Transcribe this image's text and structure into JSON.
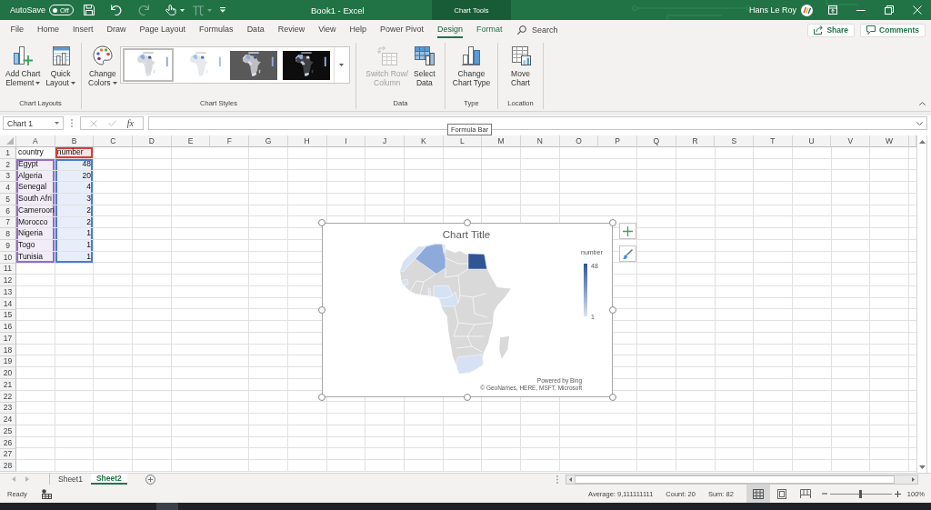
{
  "title_bar": {
    "autosave": {
      "label": "AutoSave",
      "state": "Off",
      "on": false
    },
    "quick_access": [
      {
        "kind": "save",
        "disabled": false,
        "dropdown": false
      },
      {
        "kind": "undo",
        "disabled": false,
        "dropdown": false
      },
      {
        "kind": "redo",
        "disabled": true,
        "dropdown": false
      },
      {
        "kind": "touch",
        "disabled": false,
        "dropdown": true
      },
      {
        "kind": "equation",
        "disabled": true,
        "dropdown": true
      },
      {
        "kind": "customize",
        "disabled": false,
        "dropdown": false
      }
    ],
    "document_title": "Book1 - Excel",
    "context_tab_group": "Chart Tools",
    "user_name": "Hans Le Roy"
  },
  "ribbon_tabs": [
    {
      "label": "File",
      "selected": false,
      "contextual": false
    },
    {
      "label": "Home",
      "selected": false,
      "contextual": false
    },
    {
      "label": "Insert",
      "selected": false,
      "contextual": false
    },
    {
      "label": "Draw",
      "selected": false,
      "contextual": false
    },
    {
      "label": "Page Layout",
      "selected": false,
      "contextual": false
    },
    {
      "label": "Formulas",
      "selected": false,
      "contextual": false
    },
    {
      "label": "Data",
      "selected": false,
      "contextual": false
    },
    {
      "label": "Review",
      "selected": false,
      "contextual": false
    },
    {
      "label": "View",
      "selected": false,
      "contextual": false
    },
    {
      "label": "Help",
      "selected": false,
      "contextual": false
    },
    {
      "label": "Power Pivot",
      "selected": false,
      "contextual": false
    },
    {
      "label": "Design",
      "selected": true,
      "contextual": true
    },
    {
      "label": "Format",
      "selected": false,
      "contextual": true
    }
  ],
  "search": {
    "placeholder": "Search"
  },
  "share_button": {
    "label": "Share"
  },
  "comments_button": {
    "label": "Comments"
  },
  "ribbon_groups": [
    {
      "label": "Chart Layouts",
      "commands": [
        {
          "kind": "add-chart-element",
          "label": "Add Chart\nElement",
          "dropdown": true,
          "disabled": false
        },
        {
          "kind": "quick-layout",
          "label": "Quick\nLayout",
          "dropdown": true,
          "disabled": false
        }
      ]
    },
    {
      "label": "Chart Styles",
      "commands": [
        {
          "kind": "change-colors",
          "label": "Change\nColors",
          "dropdown": true,
          "disabled": false
        }
      ],
      "gallery": [
        {
          "kind": "light",
          "selected": true
        },
        {
          "kind": "light-flat",
          "selected": false
        },
        {
          "kind": "dark-grey",
          "selected": false
        },
        {
          "kind": "black",
          "selected": false
        }
      ]
    },
    {
      "label": "Data",
      "commands": [
        {
          "kind": "switch-row-column",
          "label": "Switch Row/\nColumn",
          "dropdown": false,
          "disabled": true
        },
        {
          "kind": "select-data",
          "label": "Select\nData",
          "dropdown": false,
          "disabled": false
        }
      ]
    },
    {
      "label": "Type",
      "commands": [
        {
          "kind": "change-chart-type",
          "label": "Change\nChart Type",
          "dropdown": false,
          "disabled": false
        }
      ]
    },
    {
      "label": "Location",
      "commands": [
        {
          "kind": "move-chart",
          "label": "Move\nChart",
          "dropdown": false,
          "disabled": false
        }
      ]
    }
  ],
  "formula_bar": {
    "name_box": "Chart 1",
    "buttons": [
      {
        "kind": "cancel",
        "disabled": true
      },
      {
        "kind": "enter",
        "disabled": true
      },
      {
        "kind": "function",
        "label": "fx",
        "disabled": false
      }
    ],
    "tooltip": "Formula Bar"
  },
  "sheet": {
    "columns": [
      "A",
      "B",
      "C",
      "D",
      "E",
      "F",
      "G",
      "H",
      "I",
      "J",
      "K",
      "L",
      "M",
      "N",
      "O",
      "P",
      "Q",
      "R",
      "S",
      "T",
      "U",
      "V",
      "W"
    ],
    "rows": [
      {
        "label": "1",
        "cells": [
          {
            "text": "country",
            "kind": "text"
          },
          {
            "text": "number",
            "kind": "text",
            "color": "#d63c3c"
          }
        ]
      },
      {
        "label": "2",
        "cells": [
          {
            "text": "Egypt",
            "kind": "text",
            "color": "#9070c4"
          },
          {
            "text": "48",
            "kind": "number",
            "color": "#4a7bd0"
          }
        ]
      },
      {
        "label": "3",
        "cells": [
          {
            "text": "Algeria",
            "kind": "text",
            "color": "#9070c4"
          },
          {
            "text": "20",
            "kind": "number",
            "color": "#4a7bd0"
          }
        ]
      },
      {
        "label": "4",
        "cells": [
          {
            "text": "Senegal",
            "kind": "text",
            "color": "#9070c4"
          },
          {
            "text": "4",
            "kind": "number",
            "color": "#4a7bd0"
          }
        ]
      },
      {
        "label": "5",
        "cells": [
          {
            "text": "South Afri",
            "kind": "text",
            "color": "#9070c4"
          },
          {
            "text": "3",
            "kind": "number",
            "color": "#4a7bd0"
          }
        ]
      },
      {
        "label": "6",
        "cells": [
          {
            "text": "Cameroon",
            "kind": "text",
            "color": "#9070c4"
          },
          {
            "text": "2",
            "kind": "number",
            "color": "#4a7bd0"
          }
        ]
      },
      {
        "label": "7",
        "cells": [
          {
            "text": "Morocco",
            "kind": "text",
            "color": "#9070c4"
          },
          {
            "text": "2",
            "kind": "number",
            "color": "#4a7bd0"
          }
        ]
      },
      {
        "label": "8",
        "cells": [
          {
            "text": "Nigeria",
            "kind": "text",
            "color": "#9070c4"
          },
          {
            "text": "1",
            "kind": "number",
            "color": "#4a7bd0"
          }
        ]
      },
      {
        "label": "9",
        "cells": [
          {
            "text": "Togo",
            "kind": "text",
            "color": "#9070c4"
          },
          {
            "text": "1",
            "kind": "number",
            "color": "#4a7bd0"
          }
        ]
      },
      {
        "label": "10",
        "cells": [
          {
            "text": "Tunisia",
            "kind": "text",
            "color": "#9070c4"
          },
          {
            "text": "1",
            "kind": "number",
            "color": "#4a7bd0"
          }
        ]
      },
      {
        "label": "11"
      },
      {
        "label": "12"
      },
      {
        "label": "13"
      },
      {
        "label": "14"
      },
      {
        "label": "15"
      },
      {
        "label": "16"
      },
      {
        "label": "17"
      },
      {
        "label": "18"
      },
      {
        "label": "19"
      },
      {
        "label": "20"
      },
      {
        "label": "21"
      },
      {
        "label": "22"
      },
      {
        "label": "23"
      },
      {
        "label": "24"
      },
      {
        "label": "25"
      },
      {
        "label": "26"
      },
      {
        "label": "27"
      },
      {
        "label": "28"
      }
    ]
  },
  "chart": {
    "selected": true,
    "title": "Chart Title",
    "legend": {
      "title": "number",
      "max_label": "48",
      "min_label": "1"
    },
    "attribution": [
      "Powered by Bing",
      "© GeoNames, HERE, MSFT, Microsoft"
    ],
    "side_buttons": [
      {
        "kind": "elements"
      },
      {
        "kind": "styles"
      }
    ]
  },
  "sheet_tabs": [
    {
      "label": "Sheet1",
      "selected": false
    },
    {
      "label": "Sheet2",
      "selected": true
    }
  ],
  "status_bar": {
    "mode": "Ready",
    "stats": [
      "Average: 9,111111111",
      "Count: 20",
      "Sum: 82"
    ],
    "views": [
      {
        "kind": "normal",
        "selected": true
      },
      {
        "kind": "page-layout",
        "selected": false
      },
      {
        "kind": "page-break-preview",
        "selected": false
      }
    ],
    "zoom": {
      "level": 0.5,
      "label": "100%"
    }
  }
}
